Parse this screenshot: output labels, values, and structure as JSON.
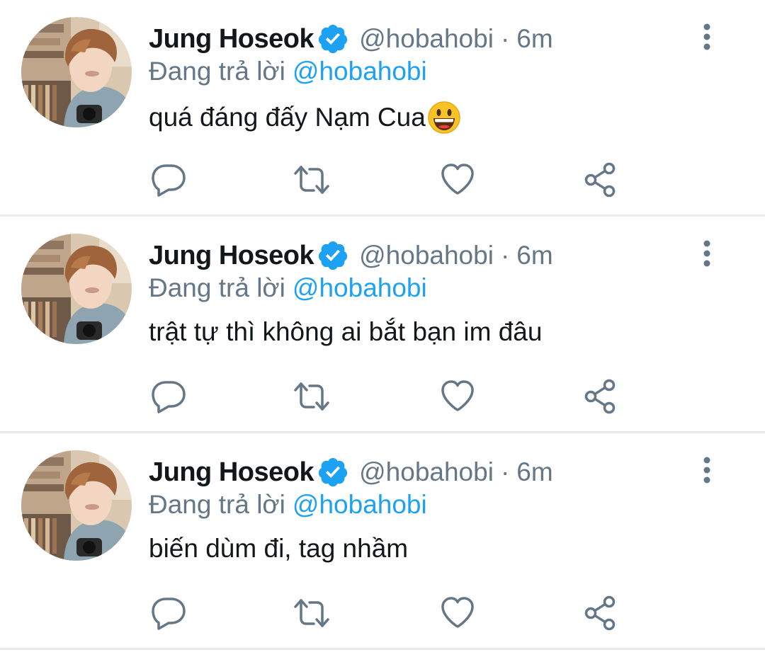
{
  "colors": {
    "name": "#14171a",
    "secondary": "#657786",
    "accent": "#1da1f2",
    "divider": "#e6ecf0"
  },
  "tweets": [
    {
      "display_name": "Jung Hoseok",
      "handle": "@hobahobi",
      "separator": "·",
      "time": "6m",
      "reply_prefix": "Đang trả lời",
      "reply_to": "@hobahobi",
      "text": "quá đáng đấy Nạm Cua",
      "emoji": "grinning-face-emoji",
      "verified": true
    },
    {
      "display_name": "Jung Hoseok",
      "handle": "@hobahobi",
      "separator": "·",
      "time": "6m",
      "reply_prefix": "Đang trả lời",
      "reply_to": "@hobahobi",
      "text": "trật tự thì không ai bắt bạn im đâu",
      "verified": true
    },
    {
      "display_name": "Jung Hoseok",
      "handle": "@hobahobi",
      "separator": "·",
      "time": "6m",
      "reply_prefix": "Đang trả lời",
      "reply_to": "@hobahobi",
      "text": "biến dùm đi, tag nhầm",
      "verified": true
    }
  ],
  "icons": {
    "more": "more-vertical-icon",
    "reply": "reply-icon",
    "retweet": "retweet-icon",
    "like": "heart-icon",
    "share": "share-icon",
    "verified": "verified-badge-icon"
  }
}
